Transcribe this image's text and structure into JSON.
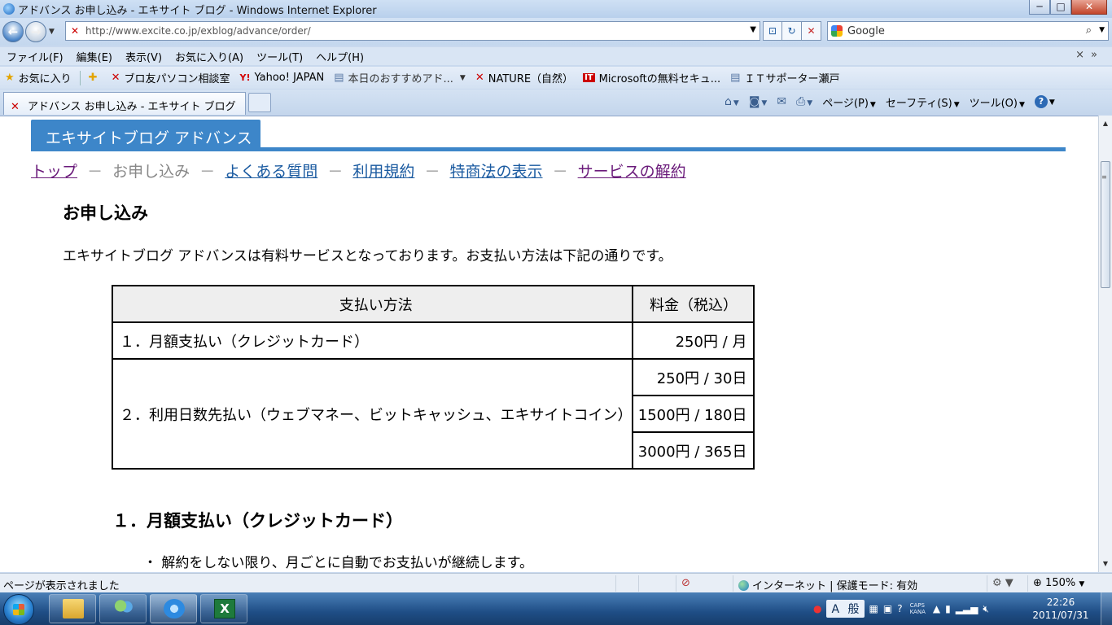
{
  "window": {
    "title": "アドバンス お申し込み - エキサイト ブログ - Windows Internet Explorer",
    "minimize": "─",
    "maximize": "□",
    "close": "✕"
  },
  "address_bar": {
    "url": "http://www.excite.co.jp/exblog/advance/order/",
    "search_placeholder": "Google"
  },
  "menu": [
    "ファイル(F)",
    "編集(E)",
    "表示(V)",
    "お気に入り(A)",
    "ツール(T)",
    "ヘルプ(H)"
  ],
  "favorites_bar": {
    "favorites_label": "お気に入り",
    "items": [
      "ブロ友パソコン相談室",
      "Yahoo! JAPAN",
      "本日のおすすめアド...",
      "NATURE（自然）",
      "Microsoftの無料セキュ...",
      "ＩＴサポーター瀬戸"
    ]
  },
  "tab": {
    "label": "アドバンス お申し込み - エキサイト ブログ"
  },
  "command_bar": {
    "page": "ページ(P)",
    "safety": "セーフティ(S)",
    "tools": "ツール(O)",
    "help": "?"
  },
  "content": {
    "banner": "エキサイトブログ アドバンス",
    "breadcrumbs": {
      "top": "トップ",
      "current": "お申し込み",
      "faq": "よくある質問",
      "terms": "利用規約",
      "law": "特商法の表示",
      "cancel": "サービスの解約",
      "sep": "－"
    },
    "heading": "お申し込み",
    "intro": "エキサイトブログ アドバンスは有料サービスとなっております。お支払い方法は下記の通りです。",
    "table": {
      "headers": [
        "支払い方法",
        "料金（税込）"
      ],
      "row1": {
        "method": "１．月額支払い（クレジットカード）",
        "price": "250円 / 月"
      },
      "row2": {
        "method": "２．利用日数先払い（ウェブマネー、ビットキャッシュ、エキサイトコイン）",
        "prices": [
          "250円 / 30日",
          "1500円 / 180日",
          "3000円 / 365日"
        ]
      }
    },
    "section_heading": "１．月額支払い（クレジットカード）",
    "bullet": "・ 解約をしない限り、月ごとに自動でお支払いが継続します。"
  },
  "status_bar": {
    "text": "ページが表示されました",
    "zone": "インターネット | 保護モード: 有効",
    "zoom": "150%"
  },
  "taskbar": {
    "ime_a": "A",
    "ime_mode": "般",
    "caps": "CAPS",
    "kana": "KANA",
    "time": "22:26",
    "date": "2011/07/31"
  }
}
